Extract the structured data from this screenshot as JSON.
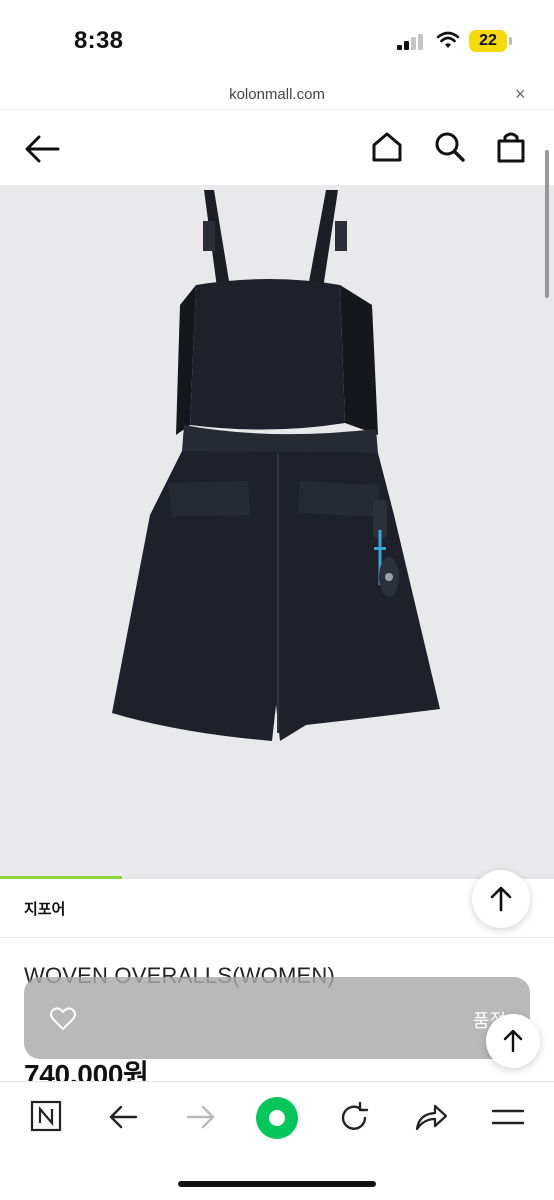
{
  "status": {
    "time": "8:38",
    "battery": "22"
  },
  "browser": {
    "url": "kolonmall.com",
    "close_glyph": "×"
  },
  "product": {
    "brand": "지포어",
    "name": "WOVEN OVERALLS(WOMEN)",
    "price": "740,000원",
    "image_progress": 0.22
  },
  "action_bar": {
    "status_label": "품절"
  },
  "icons": {
    "header": [
      "back-arrow-icon",
      "home-icon",
      "search-icon",
      "bag-icon"
    ],
    "toolbar": [
      "naver-n-icon",
      "back-icon",
      "forward-icon",
      "naver-green-dot-icon",
      "reload-icon",
      "share-icon",
      "menu-icon"
    ]
  },
  "colors": {
    "accent_green": "#8ad53a",
    "naver_green": "#03c75a",
    "battery_yellow": "#f5d90a"
  }
}
